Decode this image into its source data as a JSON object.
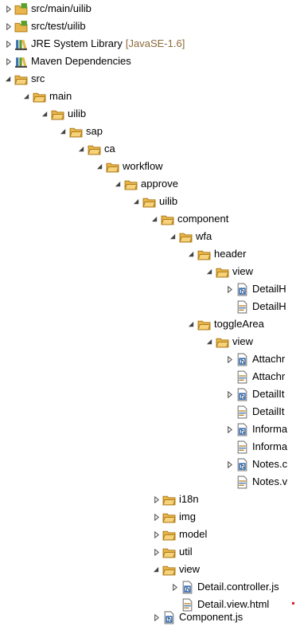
{
  "tree": {
    "src_main_uilib": "src/main/uilib",
    "src_test_uilib": "src/test/uilib",
    "jre_library": "JRE System Library",
    "jre_version": "[JavaSE-1.6]",
    "maven_dependencies": "Maven Dependencies",
    "src": "src",
    "main": "main",
    "uilib": "uilib",
    "sap": "sap",
    "ca": "ca",
    "workflow": "workflow",
    "approve": "approve",
    "uilib2": "uilib",
    "component": "component",
    "wfa": "wfa",
    "header": "header",
    "header_view": "view",
    "header_file1": "DetailH",
    "header_file2": "DetailH",
    "toggleArea": "toggleArea",
    "toggle_view": "view",
    "toggle_files": [
      "Attachr",
      "Attachr",
      "DetailIt",
      "DetailIt",
      "Informa",
      "Informa",
      "Notes.c",
      "Notes.v"
    ],
    "i18n": "i18n",
    "img": "img",
    "model": "model",
    "util": "util",
    "view": "view",
    "detail_controller": "Detail.controller.js",
    "detail_view": "Detail.view.html",
    "component_js": "Component.js"
  },
  "colors": {
    "folder_fill": "#e8b64a",
    "folder_dark": "#b07d1a",
    "package_green": "#5aa02c",
    "js_blue": "#3a6fb0",
    "twisty": "#555555"
  }
}
